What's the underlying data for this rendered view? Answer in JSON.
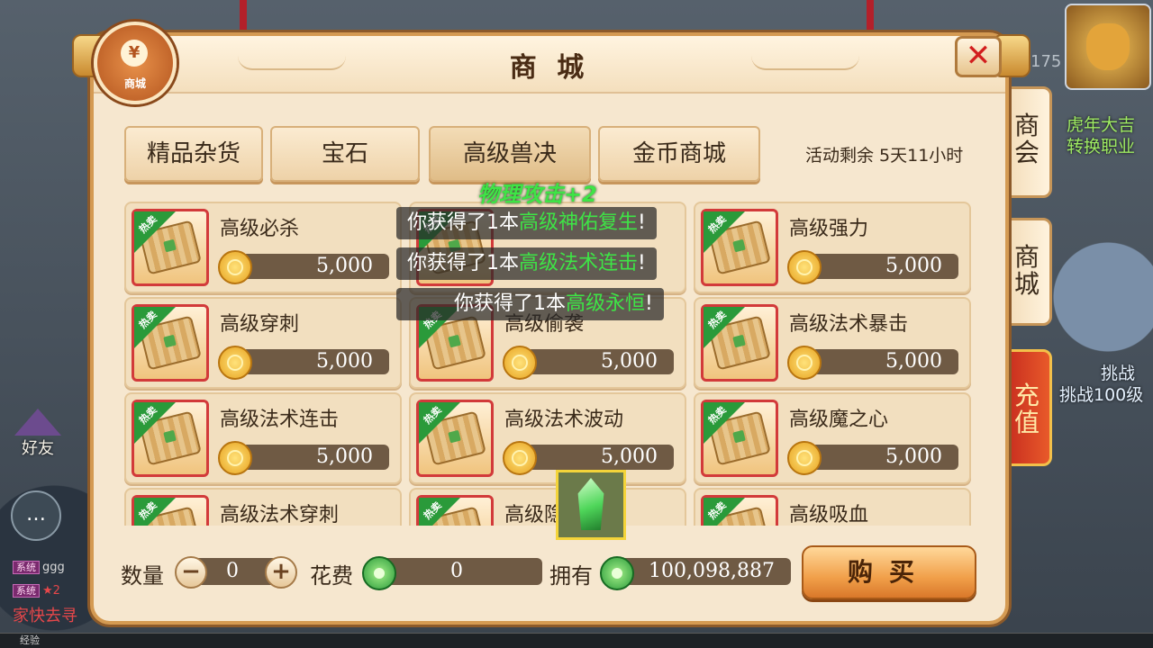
{
  "hud": {
    "friend_label": "好友",
    "chat_icon": "…",
    "sys_tag": "系统",
    "chat_line_1": "ggg",
    "chat_line_2": "★2",
    "hint_text": "家快去寻",
    "level_num": "175",
    "right_text_1": "虎年大吉",
    "right_text_2": "转换职业",
    "right_text_3": "挑战",
    "right_text_4": "挑战100级",
    "exp_label": "经验"
  },
  "panel": {
    "title": "商 城",
    "shop_icon_glyph": "¥",
    "shop_icon_label": "商城",
    "close_glyph": "✕",
    "event_remaining": "活动剩余 5天11小时",
    "categories": [
      "精品杂货",
      "宝石",
      "高级兽决",
      "金币商城"
    ],
    "side_tabs": [
      "商会",
      "商城",
      "充值"
    ]
  },
  "items": [
    {
      "name": "高级必杀",
      "price": "5,000",
      "hot": "热卖"
    },
    {
      "name": "",
      "price": "",
      "hot": "热卖"
    },
    {
      "name": "高级强力",
      "price": "5,000",
      "hot": "热卖"
    },
    {
      "name": "高级穿刺",
      "price": "5,000",
      "hot": "热卖"
    },
    {
      "name": "高级偷袭",
      "price": "5,000",
      "hot": "热卖"
    },
    {
      "name": "高级法术暴击",
      "price": "5,000",
      "hot": "热卖"
    },
    {
      "name": "高级法术连击",
      "price": "5,000",
      "hot": "热卖"
    },
    {
      "name": "高级法术波动",
      "price": "5,000",
      "hot": "热卖"
    },
    {
      "name": "高级魔之心",
      "price": "5,000",
      "hot": "热卖"
    },
    {
      "name": "高级法术穿刺",
      "price": "",
      "hot": "热卖"
    },
    {
      "name": "高级隐",
      "price": "",
      "hot": "热卖"
    },
    {
      "name": "高级吸血",
      "price": "",
      "hot": "热卖"
    }
  ],
  "overlay": {
    "combat_text": "物理攻击+2",
    "toasts": [
      {
        "prefix": "你获得了1本",
        "item": "高级神佑复生",
        "suffix": "!"
      },
      {
        "prefix": "你获得了1本",
        "item": "高级法术连击",
        "suffix": "!"
      },
      {
        "prefix": "你获得了1本",
        "item": "高级永恒",
        "suffix": "!"
      }
    ]
  },
  "purchase": {
    "quantity_label": "数量",
    "minus": "−",
    "plus": "+",
    "quantity_value": "0",
    "cost_label": "花费",
    "cost_value": "0",
    "owned_label": "拥有",
    "owned_value": "100,098,887",
    "buy_label": "购买"
  },
  "colors": {
    "panel_bg": "#f6e7cf",
    "accent_green": "#3ee446",
    "frame_red": "#d23a3a",
    "hot_green": "#2a9a3a"
  }
}
